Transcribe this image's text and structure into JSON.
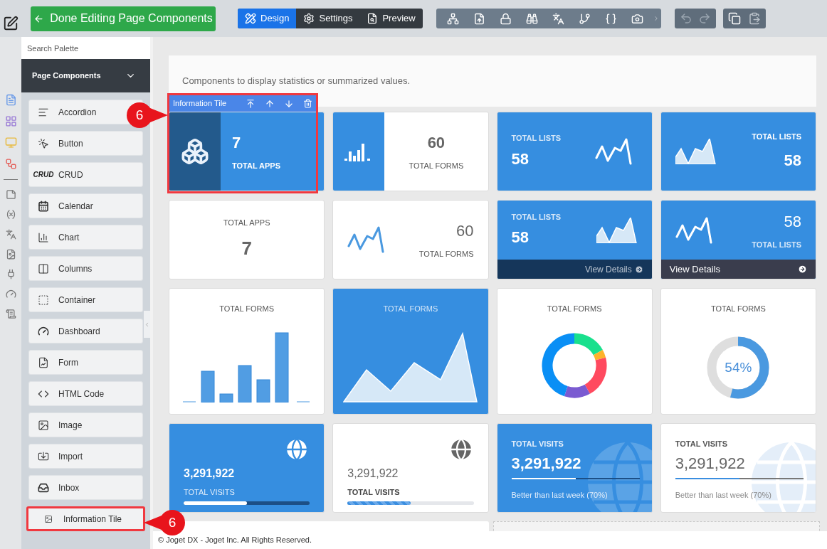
{
  "toolbar": {
    "done_button": "Done Editing Page Components",
    "modes": [
      {
        "label": "Design",
        "selected": true
      },
      {
        "label": "Settings",
        "selected": false
      },
      {
        "label": "Preview",
        "selected": false
      }
    ]
  },
  "palette": {
    "search_placeholder": "Search Palette",
    "section": {
      "title": "Page Components",
      "expanded": true
    },
    "callout": "6",
    "items": [
      {
        "label": "Accordion",
        "highlighted": false
      },
      {
        "label": "Button",
        "highlighted": false
      },
      {
        "label": "CRUD",
        "icon_text": "CRUD",
        "highlighted": false
      },
      {
        "label": "Calendar",
        "highlighted": false
      },
      {
        "label": "Chart",
        "highlighted": false
      },
      {
        "label": "Columns",
        "highlighted": false
      },
      {
        "label": "Container",
        "highlighted": false
      },
      {
        "label": "Dashboard",
        "highlighted": false
      },
      {
        "label": "Form",
        "highlighted": false
      },
      {
        "label": "HTML Code",
        "highlighted": false
      },
      {
        "label": "Image",
        "highlighted": false
      },
      {
        "label": "Import",
        "highlighted": false
      },
      {
        "label": "Inbox",
        "highlighted": false
      },
      {
        "label": "Information Tile",
        "highlighted": true
      }
    ]
  },
  "canvas": {
    "description": "Components to display statistics or summarized values.",
    "selection": {
      "label": "Information Tile",
      "callout": "6"
    },
    "tiles": [
      {
        "kind": "icon-panel",
        "filled": true,
        "value": "7",
        "label": "TOTAL APPS"
      },
      {
        "kind": "chart-panel",
        "filled": false,
        "value": "60",
        "label": "TOTAL FORMS"
      },
      {
        "kind": "line-right",
        "filled": true,
        "label": "TOTAL LISTS",
        "value": "58"
      },
      {
        "kind": "area-left",
        "filled": true,
        "label": "TOTAL LISTS",
        "value": "58"
      },
      {
        "kind": "centered",
        "filled": false,
        "label": "TOTAL APPS",
        "value": "7"
      },
      {
        "kind": "line-left",
        "filled": false,
        "value": "60",
        "label": "TOTAL FORMS"
      },
      {
        "kind": "area-right",
        "filled": true,
        "label": "TOTAL LISTS",
        "value": "58",
        "footer": {
          "text": "View Details",
          "kind": "subtle"
        }
      },
      {
        "kind": "line-left",
        "filled": true,
        "value": "58",
        "label": "TOTAL LISTS",
        "footer": {
          "text": "View Details",
          "kind": "bar"
        }
      },
      {
        "kind": "bar-chart",
        "filled": false,
        "label": "TOTAL FORMS"
      },
      {
        "kind": "area-chart",
        "filled": true,
        "label": "TOTAL FORMS"
      },
      {
        "kind": "donut",
        "filled": false,
        "label": "TOTAL FORMS"
      },
      {
        "kind": "meter",
        "filled": false,
        "label": "TOTAL FORMS",
        "level": 0.54,
        "reading": "54%"
      },
      {
        "kind": "globe-progress",
        "filled": true,
        "value": "3,291,922",
        "label": "TOTAL VISITS",
        "level": 0.5
      },
      {
        "kind": "globe-progress",
        "filled": false,
        "value": "3,291,922",
        "label": "TOTAL VISITS",
        "level": 0.5
      },
      {
        "kind": "visits-progress",
        "filled": true,
        "label": "TOTAL VISITS",
        "value": "3,291,922",
        "level": 0.5,
        "note": "Better than last week (70%)"
      },
      {
        "kind": "visits-progress",
        "filled": false,
        "label": "TOTAL VISITS",
        "value": "3,291,922",
        "level": 0.5,
        "note": "Better than last week (70%)"
      }
    ]
  },
  "footer": "© Joget DX - Joget Inc. All Rights Reserved."
}
